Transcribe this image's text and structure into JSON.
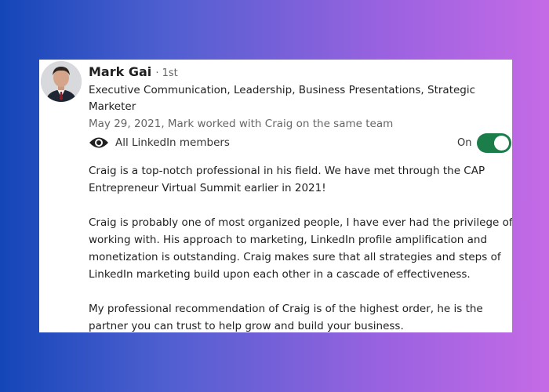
{
  "recommendation": {
    "author_name": "Mark Gai",
    "connection_degree": "· 1st",
    "headline": "Executive Communication, Leadership, Business Presentations, Strategic Marketer",
    "meta": "May 29, 2021, Mark worked with Craig on the same team",
    "visibility_label": "All LinkedIn members",
    "visibility_icon": "eye-icon",
    "toggle_label": "On",
    "toggle_on": true,
    "toggle_color": "#1a7d4a",
    "paragraphs": [
      "Craig is a top-notch professional in his field. We have met through the CAP Entrepreneur Virtual Summit earlier in 2021!",
      "Craig is probably one of most organized people, I have ever had the privilege of working with. His approach to marketing, LinkedIn profile amplification and monetization is outstanding. Craig makes sure that all strategies and steps of LinkedIn marketing build upon each other in a cascade of effectiveness.",
      "My professional recommendation of Craig is of the highest order, he is the partner you can trust to help grow and build your business."
    ]
  }
}
